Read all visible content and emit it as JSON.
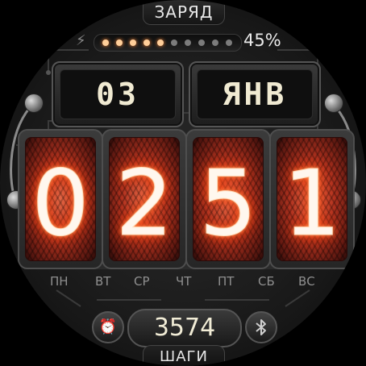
{
  "battery": {
    "label": "ЗАРЯД",
    "percent_text": "45%",
    "level": 0.45,
    "dots_total": 10,
    "dots_lit": 5,
    "icon": "lightning-bolt-icon"
  },
  "date": {
    "day": "03",
    "month": "ЯНВ"
  },
  "time": {
    "digits": [
      "0",
      "2",
      "5",
      "1"
    ]
  },
  "weekdays": [
    "ПН",
    "ВТ",
    "СР",
    "ЧТ",
    "ПТ",
    "СБ",
    "ВС"
  ],
  "steps": {
    "value": "3574",
    "label": "ШАГИ"
  },
  "icons": {
    "left_button": "alarm-clock-icon",
    "right_button": "bluetooth-icon"
  },
  "colors": {
    "nixie_glow": "#ff5a1e",
    "dot_on": "#ffcf9a",
    "text_light": "#f0ead2"
  }
}
